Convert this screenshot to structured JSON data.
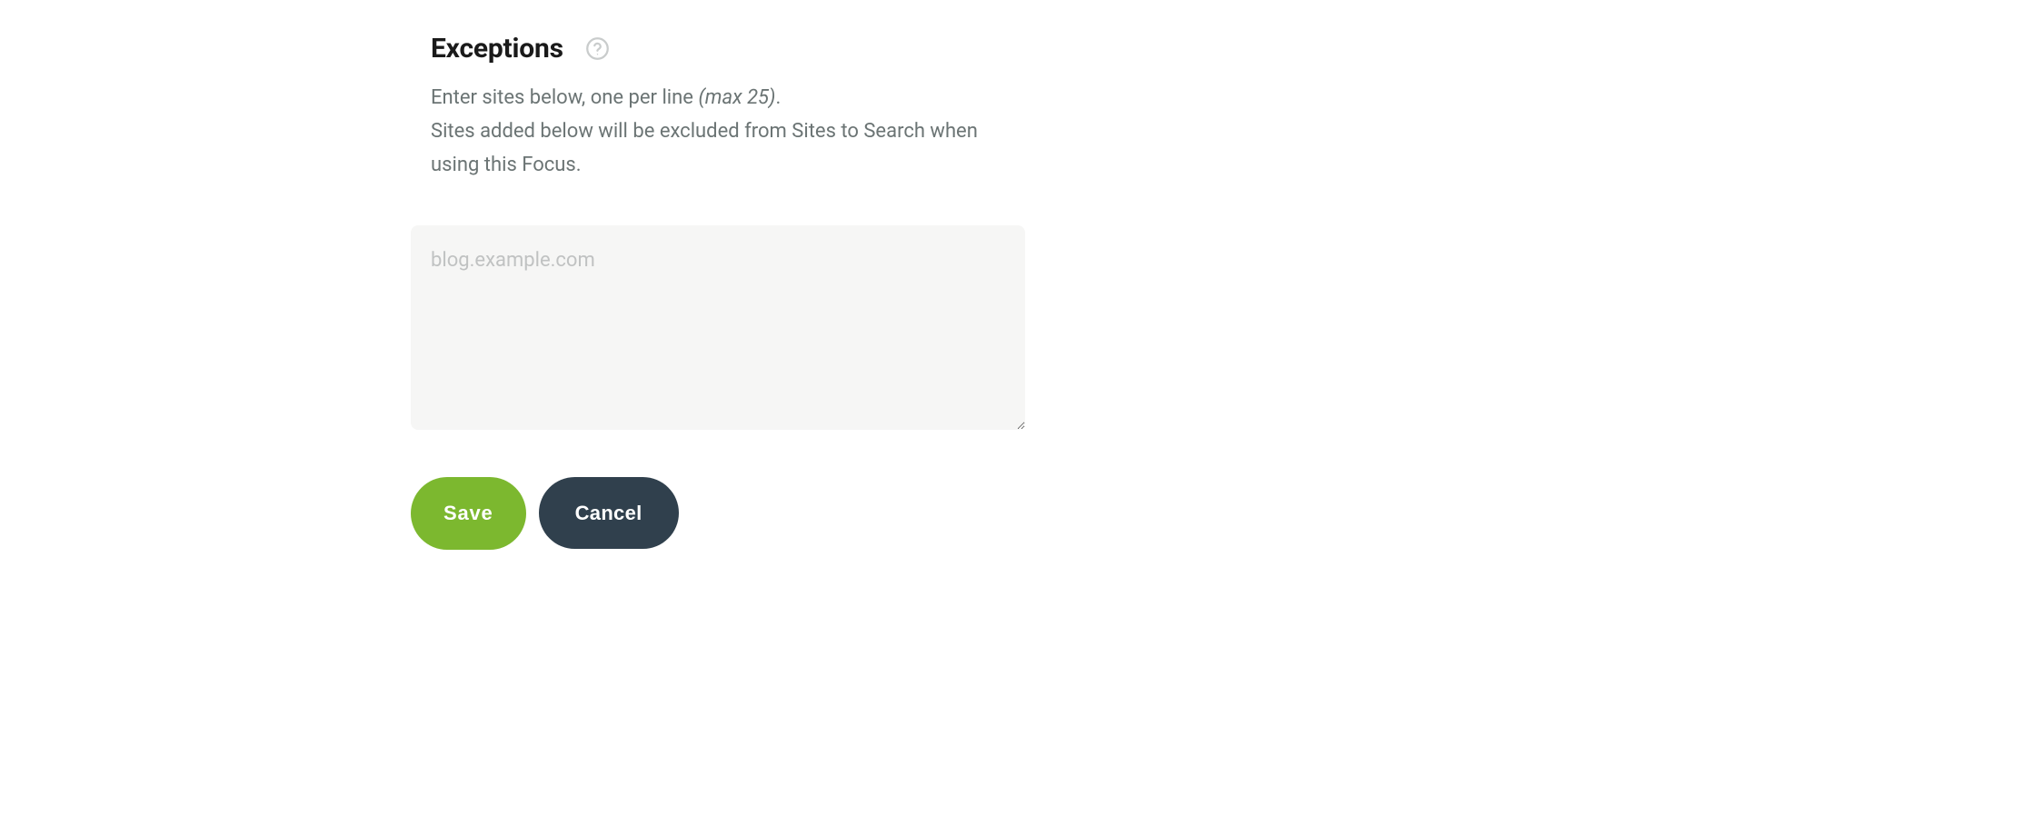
{
  "section": {
    "title": "Exceptions",
    "desc_prefix": "Enter sites below, one per line ",
    "desc_max": "(max 25)",
    "desc_period": ".",
    "desc_line2": "Sites added below will be excluded from Sites to Search when using this Focus."
  },
  "input": {
    "placeholder": "blog.example.com",
    "value": ""
  },
  "buttons": {
    "save": "Save",
    "cancel": "Cancel"
  }
}
